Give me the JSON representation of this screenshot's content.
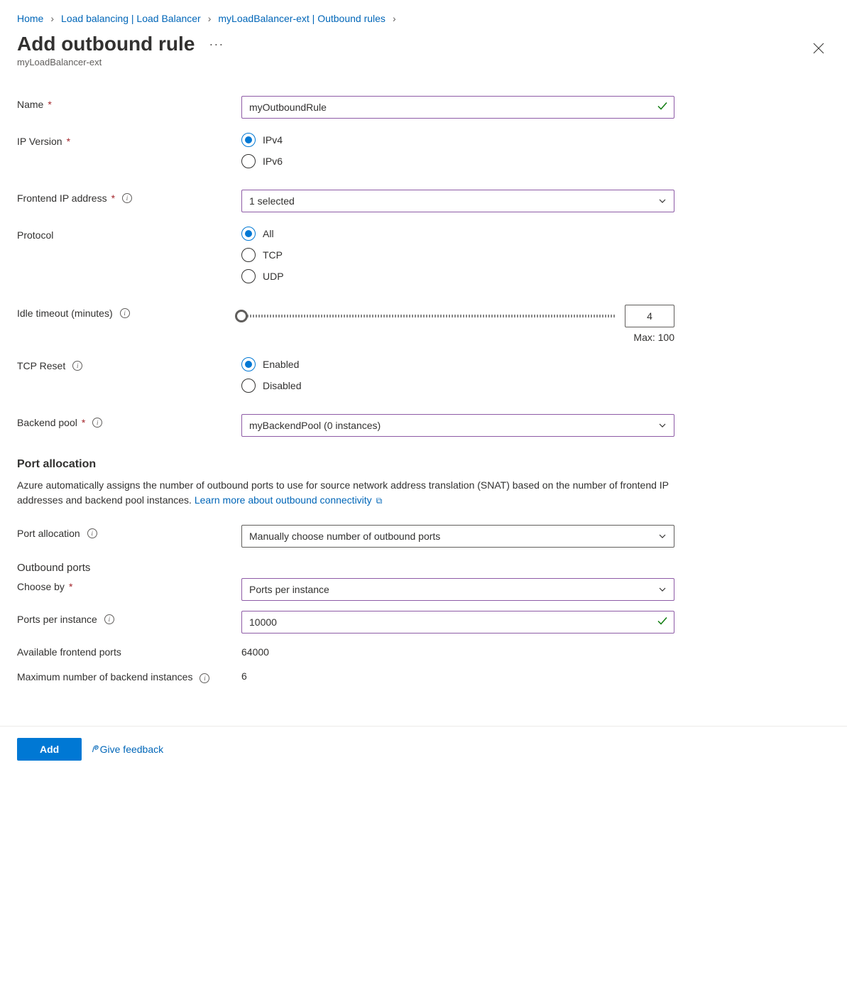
{
  "breadcrumb": {
    "items": [
      "Home",
      "Load balancing | Load Balancer",
      "myLoadBalancer-ext | Outbound rules"
    ]
  },
  "header": {
    "title": "Add outbound rule",
    "subtitle": "myLoadBalancer-ext"
  },
  "form": {
    "name": {
      "label": "Name",
      "value": "myOutboundRule"
    },
    "ipVersion": {
      "label": "IP Version",
      "options": [
        "IPv4",
        "IPv6"
      ],
      "selected": "IPv4"
    },
    "frontendIp": {
      "label": "Frontend IP address",
      "value": "1 selected"
    },
    "protocol": {
      "label": "Protocol",
      "options": [
        "All",
        "TCP",
        "UDP"
      ],
      "selected": "All"
    },
    "idleTimeout": {
      "label": "Idle timeout (minutes)",
      "value": "4",
      "maxLabel": "Max: 100"
    },
    "tcpReset": {
      "label": "TCP Reset",
      "options": [
        "Enabled",
        "Disabled"
      ],
      "selected": "Enabled"
    },
    "backendPool": {
      "label": "Backend pool",
      "value": "myBackendPool (0 instances)"
    }
  },
  "portSection": {
    "heading": "Port allocation",
    "desc": "Azure automatically assigns the number of outbound ports to use for source network address translation (SNAT) based on the number of frontend IP addresses and backend pool instances. ",
    "learnMore": "Learn more about outbound connectivity",
    "allocation": {
      "label": "Port allocation",
      "value": "Manually choose number of outbound ports"
    },
    "outboundPortsHeading": "Outbound ports",
    "chooseBy": {
      "label": "Choose by",
      "value": "Ports per instance"
    },
    "portsPerInstance": {
      "label": "Ports per instance",
      "value": "10000"
    },
    "availablePorts": {
      "label": "Available frontend ports",
      "value": "64000"
    },
    "maxBackend": {
      "label": "Maximum number of backend instances",
      "value": "6"
    }
  },
  "footer": {
    "addLabel": "Add",
    "feedbackLabel": "Give feedback"
  }
}
